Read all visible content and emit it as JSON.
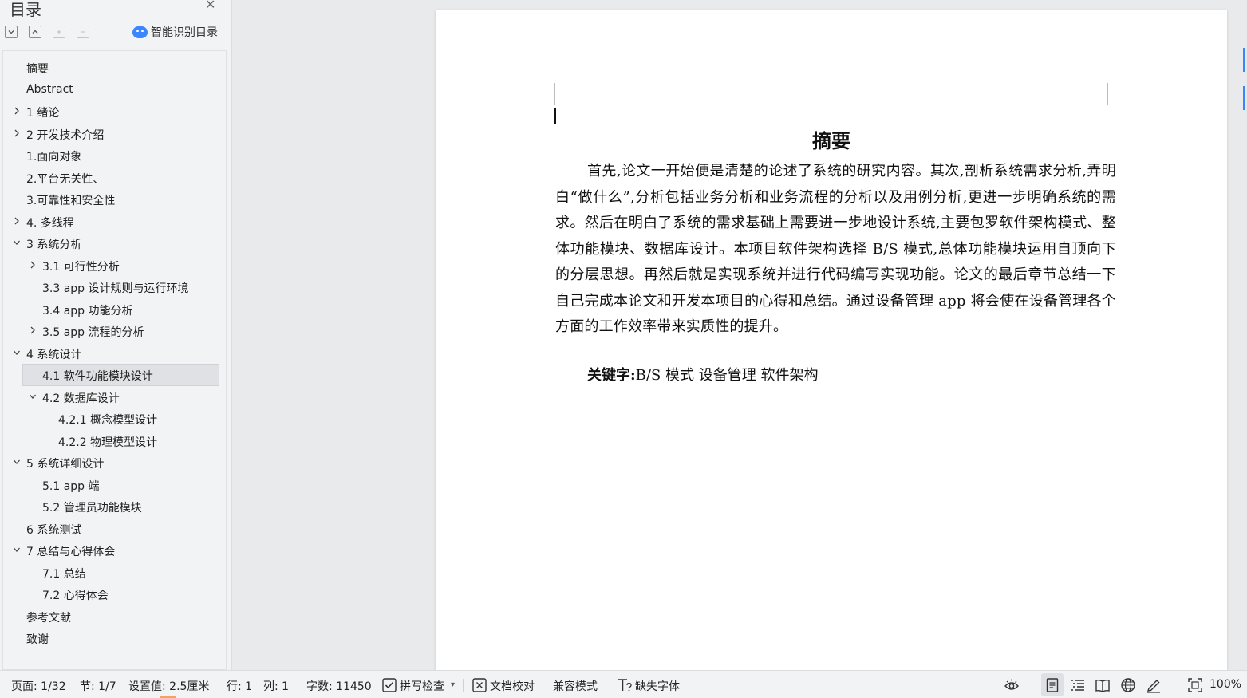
{
  "sidebar": {
    "title": "目录",
    "smart_toc_label": "智能识别目录",
    "toc": [
      {
        "label": "摘要",
        "level": 1,
        "toggle": "none"
      },
      {
        "label": "Abstract",
        "level": 1,
        "toggle": "none"
      },
      {
        "label": "1 绪论",
        "level": 1,
        "toggle": "collapsed"
      },
      {
        "label": "2 开发技术介绍",
        "level": 1,
        "toggle": "collapsed"
      },
      {
        "label": "1.面向对象",
        "level": 1,
        "toggle": "none"
      },
      {
        "label": "2.平台无关性、",
        "level": 1,
        "toggle": "none"
      },
      {
        "label": "3.可靠性和安全性",
        "level": 1,
        "toggle": "none"
      },
      {
        "label": "4.  多线程",
        "level": 1,
        "toggle": "collapsed"
      },
      {
        "label": "3 系统分析",
        "level": 1,
        "toggle": "expanded"
      },
      {
        "label": "3.1 可行性分析",
        "level": 2,
        "toggle": "collapsed"
      },
      {
        "label": "3.3 app 设计规则与运行环境",
        "level": 2,
        "toggle": "none"
      },
      {
        "label": "3.4 app 功能分析",
        "level": 2,
        "toggle": "none"
      },
      {
        "label": "3.5 app 流程的分析",
        "level": 2,
        "toggle": "collapsed"
      },
      {
        "label": "4 系统设计",
        "level": 1,
        "toggle": "expanded"
      },
      {
        "label": "4.1  软件功能模块设计",
        "level": 2,
        "toggle": "none",
        "selected": true
      },
      {
        "label": "4.2  数据库设计",
        "level": 2,
        "toggle": "expanded"
      },
      {
        "label": "4.2.1  概念模型设计",
        "level": 3,
        "toggle": "none"
      },
      {
        "label": "4.2.2  物理模型设计",
        "level": 3,
        "toggle": "none"
      },
      {
        "label": "5 系统详细设计",
        "level": 1,
        "toggle": "expanded"
      },
      {
        "label": "5.1 app 端",
        "level": 2,
        "toggle": "none"
      },
      {
        "label": "5.2 管理员功能模块",
        "level": 2,
        "toggle": "none"
      },
      {
        "label": "6 系统测试",
        "level": 1,
        "toggle": "none"
      },
      {
        "label": "7 总结与心得体会",
        "level": 1,
        "toggle": "expanded"
      },
      {
        "label": "7.1  总结",
        "level": 2,
        "toggle": "none"
      },
      {
        "label": "7.2  心得体会",
        "level": 2,
        "toggle": "none"
      },
      {
        "label": "参考文献",
        "level": 1,
        "toggle": "none"
      },
      {
        "label": "致谢",
        "level": 1,
        "toggle": "none"
      }
    ]
  },
  "document": {
    "heading": "摘要",
    "body": "首先,论文一开始便是清楚的论述了系统的研究内容。其次,剖析系统需求分析,弄明白“做什么”,分析包括业务分析和业务流程的分析以及用例分析,更进一步明确系统的需求。然后在明白了系统的需求基础上需要进一步地设计系统,主要包罗软件架构模式、整体功能模块、数据库设计。本项目软件架构选择 B/S 模式,总体功能模块运用自顶向下的分层思想。再然后就是实现系统并进行代码编写实现功能。论文的最后章节总结一下自己完成本论文和开发本项目的心得和总结。通过设备管理 app 将会使在设备管理各个方面的工作效率带来实质性的提升。",
    "keywords_label": "关键字:",
    "keywords_value": "B/S 模式  设备管理  软件架构"
  },
  "statusbar": {
    "page": "页面: 1/32",
    "section": "节: 1/7",
    "setting": "设置值: 2.5厘米",
    "row": "行: 1",
    "col": "列: 1",
    "word_count": "字数: 11450",
    "spell_check": "拼写检查",
    "doc_proof": "文档校对",
    "compat_mode": "兼容模式",
    "missing_fonts": "缺失字体",
    "zoom": "100%"
  },
  "colors": {
    "accent": "#3a86ff",
    "selected_bg": "#dfe1e5",
    "panel_bg": "#f2f3f4",
    "page_bg": "#ffffff"
  }
}
